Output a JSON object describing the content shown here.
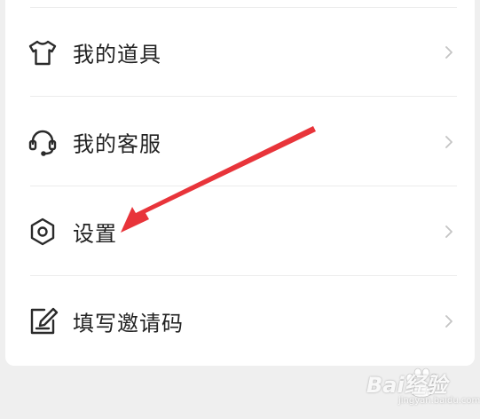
{
  "menu": {
    "items": [
      {
        "label": "我的道具",
        "icon": "tshirt-icon"
      },
      {
        "label": "我的客服",
        "icon": "headset-icon"
      },
      {
        "label": "设置",
        "icon": "hexagon-gear-icon"
      },
      {
        "label": "填写邀请码",
        "icon": "edit-note-icon"
      }
    ]
  },
  "annotation": {
    "arrow_color": "#e8343a"
  },
  "watermark": {
    "brand": "Bai经验",
    "url": "jingyan.baidu.com"
  },
  "colors": {
    "text": "#222222",
    "icon": "#2a2a2a",
    "chevron": "#c4c4c4",
    "background": "#efefef",
    "card": "#ffffff"
  }
}
